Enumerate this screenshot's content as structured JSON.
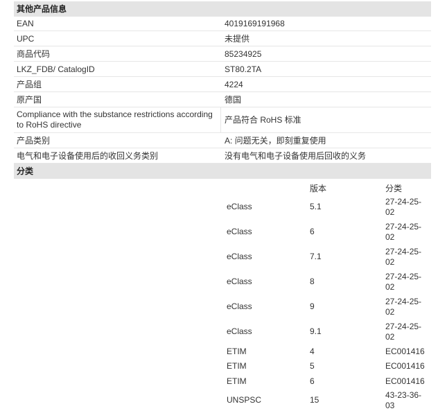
{
  "sections": {
    "other_info_title": "其他产品信息",
    "classification_title": "分类"
  },
  "info_rows": [
    {
      "label": "EAN",
      "value": "4019169191968"
    },
    {
      "label": "UPC",
      "value": "未提供"
    },
    {
      "label": "商品代码",
      "value": "85234925"
    },
    {
      "label": "LKZ_FDB/ CatalogID",
      "value": "ST80.2TA"
    },
    {
      "label": "产品组",
      "value": "4224"
    },
    {
      "label": "原产国",
      "value": "德国"
    },
    {
      "label": "Compliance with the substance restrictions according to RoHS directive",
      "value": "产品符合 RoHS 标准"
    },
    {
      "label": "产品类别",
      "value": "A: 问题无关，即刻重复使用"
    },
    {
      "label": "电气和电子设备使用后的收回义务类别",
      "value": "没有电气和电子设备使用后回收的义务"
    }
  ],
  "classification": {
    "headers": {
      "version": "版本",
      "class": "分类"
    },
    "rows": [
      {
        "system": "eClass",
        "version": "5.1",
        "class": "27-24-25-02"
      },
      {
        "system": "eClass",
        "version": "6",
        "class": "27-24-25-02"
      },
      {
        "system": "eClass",
        "version": "7.1",
        "class": "27-24-25-02"
      },
      {
        "system": "eClass",
        "version": "8",
        "class": "27-24-25-02"
      },
      {
        "system": "eClass",
        "version": "9",
        "class": "27-24-25-02"
      },
      {
        "system": "eClass",
        "version": "9.1",
        "class": "27-24-25-02"
      },
      {
        "system": "ETIM",
        "version": "4",
        "class": "EC001416"
      },
      {
        "system": "ETIM",
        "version": "5",
        "class": "EC001416"
      },
      {
        "system": "ETIM",
        "version": "6",
        "class": "EC001416"
      },
      {
        "system": "UNSPSC",
        "version": "15",
        "class": "43-23-36-03"
      }
    ]
  }
}
